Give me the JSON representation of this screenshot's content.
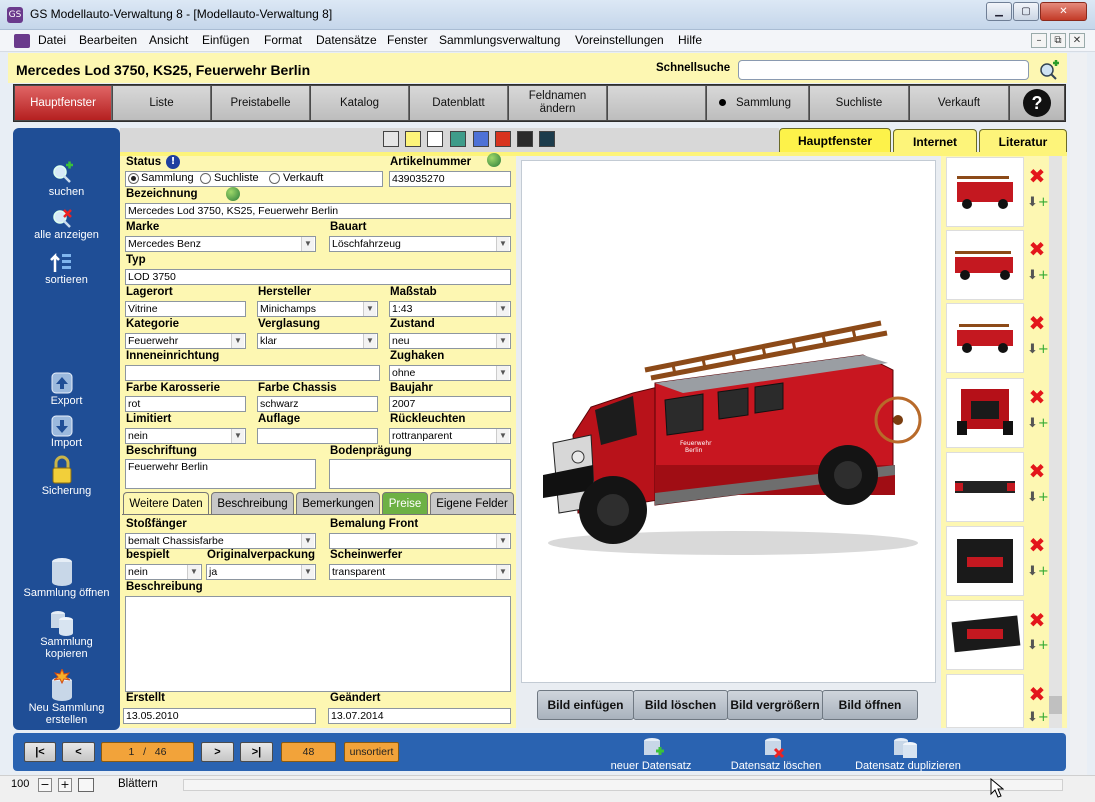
{
  "window": {
    "title": "GS Modellauto-Verwaltung 8 - [Modellauto-Verwaltung 8]",
    "minimize": "▁",
    "maximize": "▢",
    "close": "✕"
  },
  "menu": [
    "Datei",
    "Bearbeiten",
    "Ansicht",
    "Einfügen",
    "Format",
    "Datensätze",
    "Fenster",
    "Sammlungsverwaltung",
    "Voreinstellungen",
    "Hilfe"
  ],
  "mdi": {
    "min": "–",
    "restore": "⧉",
    "close": "✕"
  },
  "header": {
    "record_title": "Mercedes Lod 3750, KS25, Feuerwehr Berlin",
    "quick_search_label": "Schnellsuche",
    "quick_search_value": ""
  },
  "nav": [
    {
      "label": "Hauptfenster"
    },
    {
      "label": "Liste"
    },
    {
      "label": "Preistabelle"
    },
    {
      "label": "Katalog"
    },
    {
      "label": "Datenblatt"
    },
    {
      "label": "Feldnamen ändern"
    },
    {
      "label": ""
    },
    {
      "label": "Sammlung"
    },
    {
      "label": "Suchliste"
    },
    {
      "label": "Verkauft"
    },
    {
      "label": "?"
    }
  ],
  "left_panel": {
    "search": "suchen",
    "show_all": "alle anzeigen",
    "sort": "sortieren",
    "export": "Export",
    "import": "Import",
    "backup": "Sicherung",
    "open": "Sammlung öffnen",
    "copy": "Sammlung kopieren",
    "new": "Neu Sammlung erstellen"
  },
  "colors": {
    "swatches": [
      "#e6e6e6",
      "#fdf47a",
      "#ffffff",
      "#3e9c8a",
      "#4e72d6",
      "#d8341e",
      "#2b2b2b",
      "#1c3c4c"
    ],
    "accent_red": "#c62828",
    "panel_blue": "#1f4e96",
    "form_yellow": "#fdf7b2"
  },
  "tabs": [
    "Hauptfenster",
    "Internet",
    "Literatur"
  ],
  "form": {
    "status_label": "Status",
    "status_options": [
      "Sammlung",
      "Suchliste",
      "Verkauft"
    ],
    "status_selected": "Sammlung",
    "artikelnummer_label": "Artikelnummer",
    "artikelnummer": "439035270",
    "bezeichnung_label": "Bezeichnung",
    "bezeichnung": "Mercedes Lod 3750, KS25, Feuerwehr Berlin",
    "marke_label": "Marke",
    "marke": "Mercedes Benz",
    "bauart_label": "Bauart",
    "bauart": "Löschfahrzeug",
    "typ_label": "Typ",
    "typ": "LOD 3750",
    "lagerort_label": "Lagerort",
    "lagerort": "Vitrine",
    "hersteller_label": "Hersteller",
    "hersteller": "Minichamps",
    "massstab_label": "Maßstab",
    "massstab": "1:43",
    "kategorie_label": "Kategorie",
    "kategorie": "Feuerwehr",
    "verglasung_label": "Verglasung",
    "verglasung": "klar",
    "zustand_label": "Zustand",
    "zustand": "neu",
    "inneneinrichtung_label": "Inneneinrichtung",
    "inneneinrichtung": "",
    "zughaken_label": "Zughaken",
    "zughaken": "ohne",
    "farbe_karosserie_label": "Farbe Karosserie",
    "farbe_karosserie": "rot",
    "farbe_chassis_label": "Farbe Chassis",
    "farbe_chassis": "schwarz",
    "baujahr_label": "Baujahr",
    "baujahr": "2007",
    "limitiert_label": "Limitiert",
    "limitiert": "nein",
    "auflage_label": "Auflage",
    "auflage": "",
    "rueckleuchten_label": "Rückleuchten",
    "rueckleuchten": "rottranparent",
    "beschriftung_label": "Beschriftung",
    "beschriftung": "Feuerwehr Berlin",
    "bodenpraegung_label": "Bodenprägung",
    "bodenpraegung": ""
  },
  "subtabs": [
    "Weitere Daten",
    "Beschreibung",
    "Bemerkungen",
    "Preise",
    "Eigene Felder"
  ],
  "subform": {
    "stossfaenger_label": "Stoßfänger",
    "stossfaenger": "bemalt Chassisfarbe",
    "bemalung_label": "Bemalung Front",
    "bemalung": "",
    "bespielt_label": "bespielt",
    "bespielt": "nein",
    "originalverpackung_label": "Originalverpackung",
    "originalverpackung": "ja",
    "scheinwerfer_label": "Scheinwerfer",
    "scheinwerfer": "transparent",
    "beschreibung_label": "Beschreibung",
    "beschreibung": "",
    "erstellt_label": "Erstellt",
    "erstellt": "13.05.2010",
    "geaendert_label": "Geändert",
    "geaendert": "13.07.2014"
  },
  "image_buttons": [
    "Bild einfügen",
    "Bild löschen",
    "Bild vergrößern",
    "Bild öffnen"
  ],
  "truck": {
    "door_text_1": "Feuerwehr",
    "door_text_2": "Berlin"
  },
  "pager": {
    "first": "|<",
    "prev": "<",
    "current": "1",
    "sep": "/",
    "total": "46",
    "next": ">",
    "last": ">|",
    "count": "48",
    "sort": "unsortiert"
  },
  "bottom_actions": {
    "new": "neuer Datensatz",
    "delete": "Datensatz löschen",
    "duplicate": "Datensatz duplizieren"
  },
  "statusbar": {
    "zoom": "100",
    "mode": "Blättern"
  }
}
